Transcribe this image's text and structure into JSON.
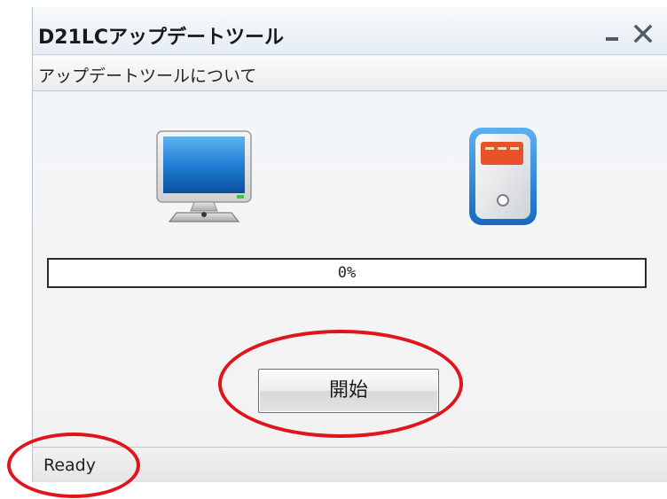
{
  "window": {
    "title": "D21LCアップデートツール",
    "controls": {
      "minimize_icon": "minimize-icon",
      "close_icon": "close-icon"
    }
  },
  "menubar": {
    "items": [
      {
        "label": "アップデートツールについて"
      }
    ]
  },
  "icons": {
    "computer": "computer-monitor-icon",
    "device": "usb-device-icon"
  },
  "progress": {
    "value": 0,
    "text": "0%"
  },
  "start_button": {
    "label": "開始"
  },
  "statusbar": {
    "text": "Ready"
  },
  "colors": {
    "annotation": "#e0141a",
    "monitor_screen": "#1a6fc4",
    "device_frame": "#2a7fd0",
    "device_stripe": "#e8512a"
  }
}
